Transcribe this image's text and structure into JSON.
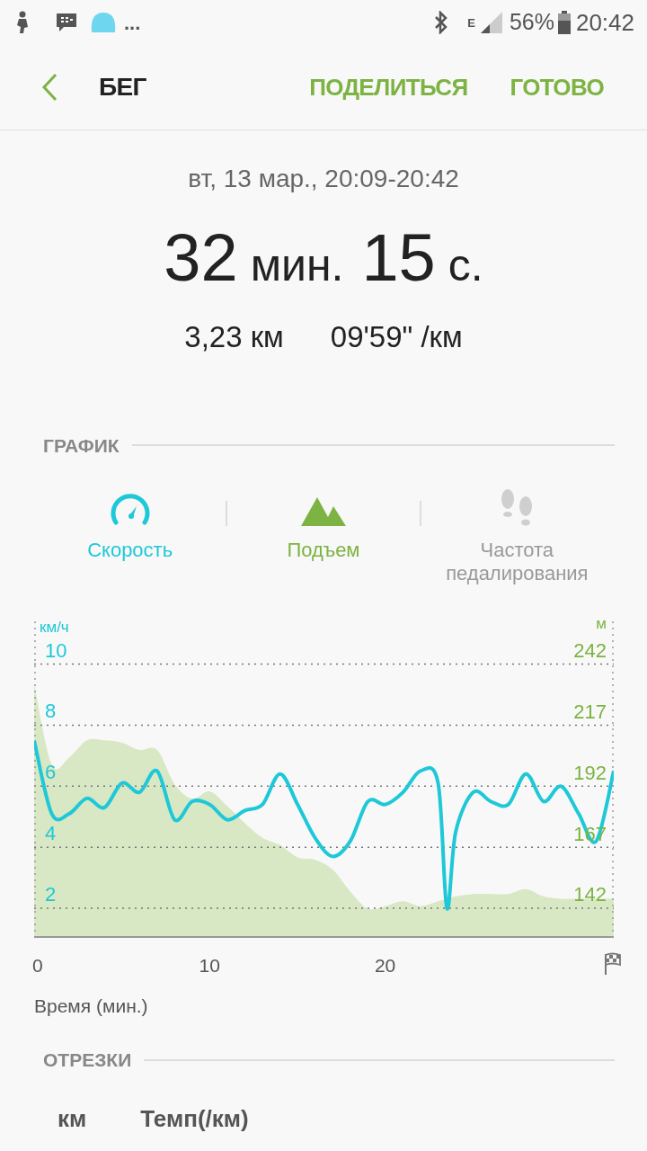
{
  "status_bar": {
    "more": "...",
    "network": "E",
    "battery": "56%",
    "time": "20:42"
  },
  "header": {
    "title": "БЕГ",
    "actions": [
      "ПОДЕЛИТЬСЯ",
      "ГОТОВО"
    ]
  },
  "summary": {
    "date": "вт, 13 мар., 20:09-20:42",
    "minutes": "32",
    "minutes_unit": "мин.",
    "seconds": "15",
    "seconds_unit": "с.",
    "distance": "3,23 км",
    "pace": "09'59\" /км"
  },
  "graph_section": {
    "title": "ГРАФИК"
  },
  "metric_tabs": [
    {
      "kind": "speed",
      "label": "Скорость",
      "selected": true
    },
    {
      "kind": "elevation",
      "label": "Подъем",
      "selected": true
    },
    {
      "kind": "cadence",
      "label": "Частота педалирования",
      "selected": false
    }
  ],
  "chart": {
    "chart_data": {
      "type": "line",
      "xlabel": "Время (мин.)",
      "ylabel": "км/ч",
      "grid": true,
      "x": [
        0,
        1,
        2,
        3,
        4,
        5,
        6,
        7,
        8,
        9,
        10,
        11,
        12,
        13,
        14,
        15,
        16,
        17,
        18,
        19,
        20,
        21,
        22,
        23,
        23.5,
        24,
        25,
        26,
        27,
        28,
        29,
        30,
        31,
        32,
        33
      ],
      "xlim": [
        0,
        33
      ],
      "ylim": [
        1.03,
        11.4
      ],
      "xticks": [
        0,
        10,
        20
      ],
      "yticks": [
        2,
        4,
        6,
        8,
        10
      ],
      "series": [
        {
          "color": "#1ec8d8",
          "values": [
            7.5,
            5.1,
            5.1,
            5.6,
            5.3,
            6.1,
            5.8,
            6.5,
            4.9,
            5.5,
            5.4,
            4.9,
            5.2,
            5.4,
            6.4,
            5.4,
            4.3,
            3.7,
            4.2,
            5.5,
            5.4,
            5.8,
            6.5,
            6.1,
            2.0,
            4.5,
            5.8,
            5.5,
            5.4,
            6.4,
            5.5,
            6.0,
            5.1,
            4.2,
            6.5
          ]
        }
      ]
    },
    "elevation_chart": {
      "chart_data": {
        "type": "area",
        "ylabel": "м",
        "x": [
          0,
          1,
          2,
          3,
          4,
          5,
          6,
          7,
          8,
          9,
          10,
          11,
          12,
          13,
          14,
          15,
          16,
          17,
          18,
          19,
          20,
          21,
          22,
          23,
          23.5,
          24,
          25,
          26,
          27,
          28,
          29,
          30,
          31,
          32,
          33
        ],
        "xlim": [
          0,
          33
        ],
        "ylim": [
          130,
          259.7
        ],
        "yticks": [
          142,
          167,
          192,
          217,
          242
        ],
        "series": [
          {
            "color": "#d8e8c4",
            "values": [
              234,
              201,
              204,
              211,
              211,
              210,
              207,
              207,
              193,
              187,
              190,
              184,
              177,
              171,
              168,
              163,
              162,
              158,
              149,
              142,
              143,
              145,
              143,
              145,
              146,
              147,
              148,
              148,
              148,
              150,
              147,
              146,
              146,
              146,
              146
            ]
          }
        ]
      }
    }
  },
  "segments_section": {
    "title": "ОТРЕЗКИ",
    "columns": [
      "км",
      "Темп(/км)"
    ]
  }
}
